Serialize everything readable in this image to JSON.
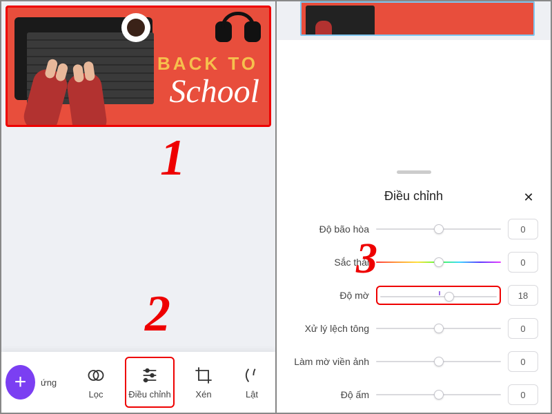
{
  "annotations": {
    "one": "1",
    "two": "2",
    "three": "3"
  },
  "image": {
    "line1": "BACK TO",
    "line2": "School"
  },
  "toolbar": {
    "fab": "+",
    "items": [
      {
        "label": "ứng",
        "icon": "sparkle"
      },
      {
        "label": "Lọc",
        "icon": "overlap"
      },
      {
        "label": "Điều chỉnh",
        "icon": "sliders"
      },
      {
        "label": "Xén",
        "icon": "crop"
      },
      {
        "label": "Lật",
        "icon": "flip"
      }
    ]
  },
  "sheet": {
    "title": "Điều chỉnh",
    "close": "✕",
    "rows": [
      {
        "label": "Độ bão hòa",
        "value": "0",
        "thumb_pct": 50,
        "rainbow": false
      },
      {
        "label": "Sắc thái",
        "value": "0",
        "thumb_pct": 50,
        "rainbow": true
      },
      {
        "label": "Độ mờ",
        "value": "18",
        "thumb_pct": 59,
        "rainbow": false,
        "highlight": true
      },
      {
        "label": "Xử lý lệch tông",
        "value": "0",
        "thumb_pct": 50,
        "rainbow": false
      },
      {
        "label": "Làm mờ viền ảnh",
        "value": "0",
        "thumb_pct": 50,
        "rainbow": false
      },
      {
        "label": "Độ ấm",
        "value": "0",
        "thumb_pct": 50,
        "rainbow": false
      }
    ]
  }
}
